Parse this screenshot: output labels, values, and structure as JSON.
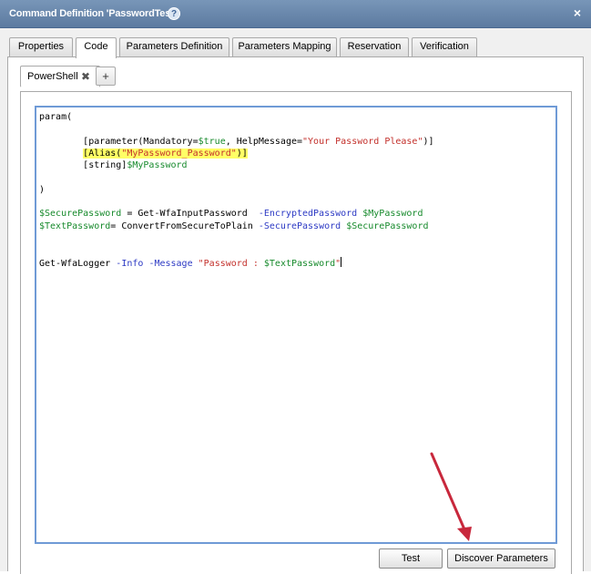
{
  "window": {
    "title": "Command Definition 'PasswordTest'",
    "help_icon": "help-icon",
    "close_glyph": "×"
  },
  "tabs": [
    {
      "label": "Properties",
      "active": false
    },
    {
      "label": "Code",
      "active": true
    },
    {
      "label": "Parameters Definition",
      "active": false
    },
    {
      "label": "Parameters Mapping",
      "active": false
    },
    {
      "label": "Reservation",
      "active": false
    },
    {
      "label": "Verification",
      "active": false
    }
  ],
  "language_tabs": {
    "active_label": "PowerShell",
    "close_glyph": "✖",
    "add_glyph": "+"
  },
  "code": {
    "line1": "param(",
    "line3a": "[parameter(Mandatory=",
    "line3b": "$true",
    "line3c": ", HelpMessage=",
    "line3d": "\"Your Password Please\"",
    "line3e": ")]",
    "line4a": "[Alias(",
    "line4b": "\"MyPassword_Password\"",
    "line4c": ")]",
    "line5a": "[string]",
    "line5b": "$MyPassword",
    "line7": ")",
    "line9a": "$SecurePassword",
    "line9b": " = Get-WfaInputPassword  ",
    "line9c": "-EncryptedPassword",
    "line9d": " ",
    "line9e": "$MyPassword",
    "line10a": "$TextPassword",
    "line10b": "= ConvertFromSecureToPlain ",
    "line10c": "-SecurePassword",
    "line10d": " ",
    "line10e": "$SecurePassword",
    "line13a": "Get-WfaLogger ",
    "line13b": "-Info",
    "line13c": " ",
    "line13d": "-Message",
    "line13e": " ",
    "line13f": "\"Password : ",
    "line13g": "$TextPassword",
    "line13h": "\""
  },
  "buttons": {
    "test": "Test",
    "discover": "Discover Parameters"
  },
  "annotation": {
    "arrow_color": "#c8283c"
  }
}
